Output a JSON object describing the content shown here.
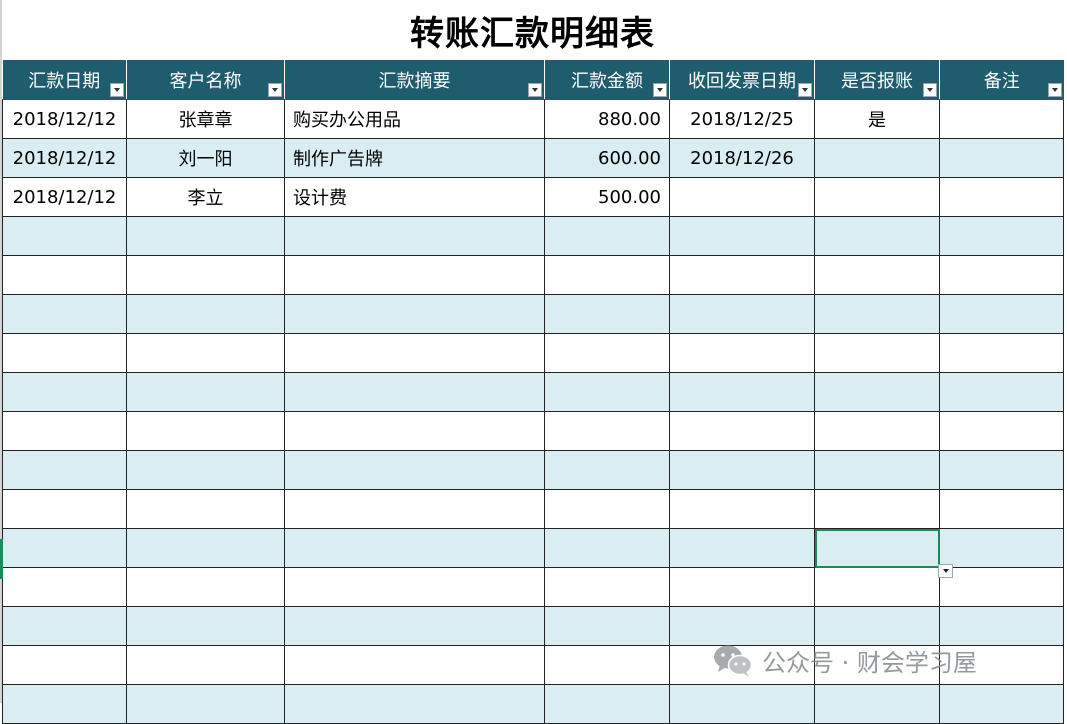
{
  "sheet": {
    "title": "转账汇款明细表"
  },
  "table": {
    "columns": [
      {
        "label": "汇款日期"
      },
      {
        "label": "客户名称"
      },
      {
        "label": "汇款摘要"
      },
      {
        "label": "汇款金额"
      },
      {
        "label": "收回发票日期"
      },
      {
        "label": "是否报账"
      },
      {
        "label": "备注"
      }
    ],
    "rows": [
      [
        "2018/12/12",
        "张章章",
        "购买办公用品",
        "880.00",
        "2018/12/25",
        "是",
        ""
      ],
      [
        "2018/12/12",
        "刘一阳",
        "制作广告牌",
        "600.00",
        "2018/12/26",
        "",
        ""
      ],
      [
        "2018/12/12",
        "李立",
        "设计费",
        "500.00",
        "",
        "",
        ""
      ],
      [
        "",
        "",
        "",
        "",
        "",
        "",
        ""
      ],
      [
        "",
        "",
        "",
        "",
        "",
        "",
        ""
      ],
      [
        "",
        "",
        "",
        "",
        "",
        "",
        ""
      ],
      [
        "",
        "",
        "",
        "",
        "",
        "",
        ""
      ],
      [
        "",
        "",
        "",
        "",
        "",
        "",
        ""
      ],
      [
        "",
        "",
        "",
        "",
        "",
        "",
        ""
      ],
      [
        "",
        "",
        "",
        "",
        "",
        "",
        ""
      ],
      [
        "",
        "",
        "",
        "",
        "",
        "",
        ""
      ],
      [
        "",
        "",
        "",
        "",
        "",
        "",
        ""
      ],
      [
        "",
        "",
        "",
        "",
        "",
        "",
        ""
      ],
      [
        "",
        "",
        "",
        "",
        "",
        "",
        ""
      ],
      [
        "",
        "",
        "",
        "",
        "",
        "",
        ""
      ],
      [
        "",
        "",
        "",
        "",
        "",
        "",
        ""
      ]
    ]
  },
  "colors": {
    "header_bg": "#1f5c6e",
    "band_bg": "#daedf3",
    "selection": "#1e8a5c"
  },
  "watermark": {
    "icon": "wechat-icon",
    "text": "公众号 · 财会学习屋"
  }
}
